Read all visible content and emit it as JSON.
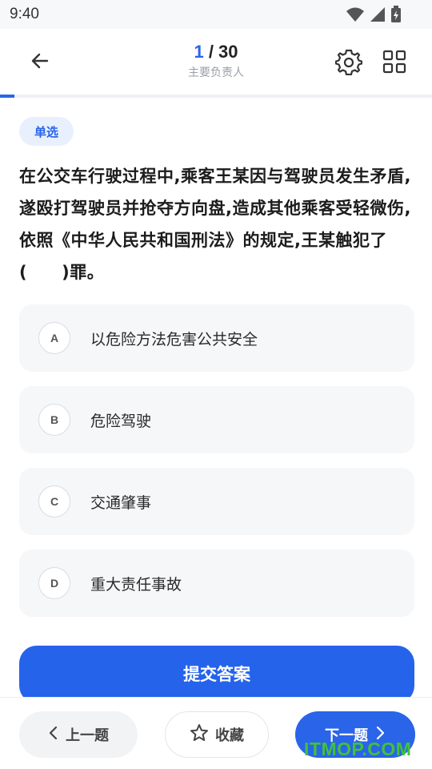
{
  "status_bar": {
    "time": "9:40"
  },
  "header": {
    "progress_current": "1",
    "progress_separator": " / ",
    "progress_total": "30",
    "subtitle": "主要负责人"
  },
  "progress": {
    "fraction": 0.034
  },
  "question": {
    "type_tag": "单选",
    "text": "在公交车行驶过程中,乘客王某因与驾驶员发生矛盾,遂殴打驾驶员并抢夺方向盘,造成其他乘客受轻微伤,依照《中华人民共和国刑法》的规定,王某触犯了(　　)罪。"
  },
  "options": [
    {
      "letter": "A",
      "text": "以危险方法危害公共安全"
    },
    {
      "letter": "B",
      "text": "危险驾驶"
    },
    {
      "letter": "C",
      "text": "交通肇事"
    },
    {
      "letter": "D",
      "text": "重大责任事故"
    }
  ],
  "actions": {
    "submit_label": "提交答案",
    "prev_label": "上一题",
    "favorite_label": "收藏",
    "next_label": "下一题"
  },
  "watermark": "ITMOP.COM",
  "colors": {
    "accent": "#2a64e8",
    "submit": "#2563eb",
    "tag_bg": "#e8f0fe",
    "option_bg": "#f6f7f9",
    "watermark": "#3fc23a"
  },
  "icons": {
    "back": "arrow-left-icon",
    "settings": "gear-icon",
    "answer_sheet": "grid-icon",
    "favorite": "star-icon",
    "prev": "chevron-left-icon",
    "next": "chevron-right-icon",
    "wifi": "wifi-icon",
    "signal": "signal-icon",
    "battery": "battery-icon"
  }
}
